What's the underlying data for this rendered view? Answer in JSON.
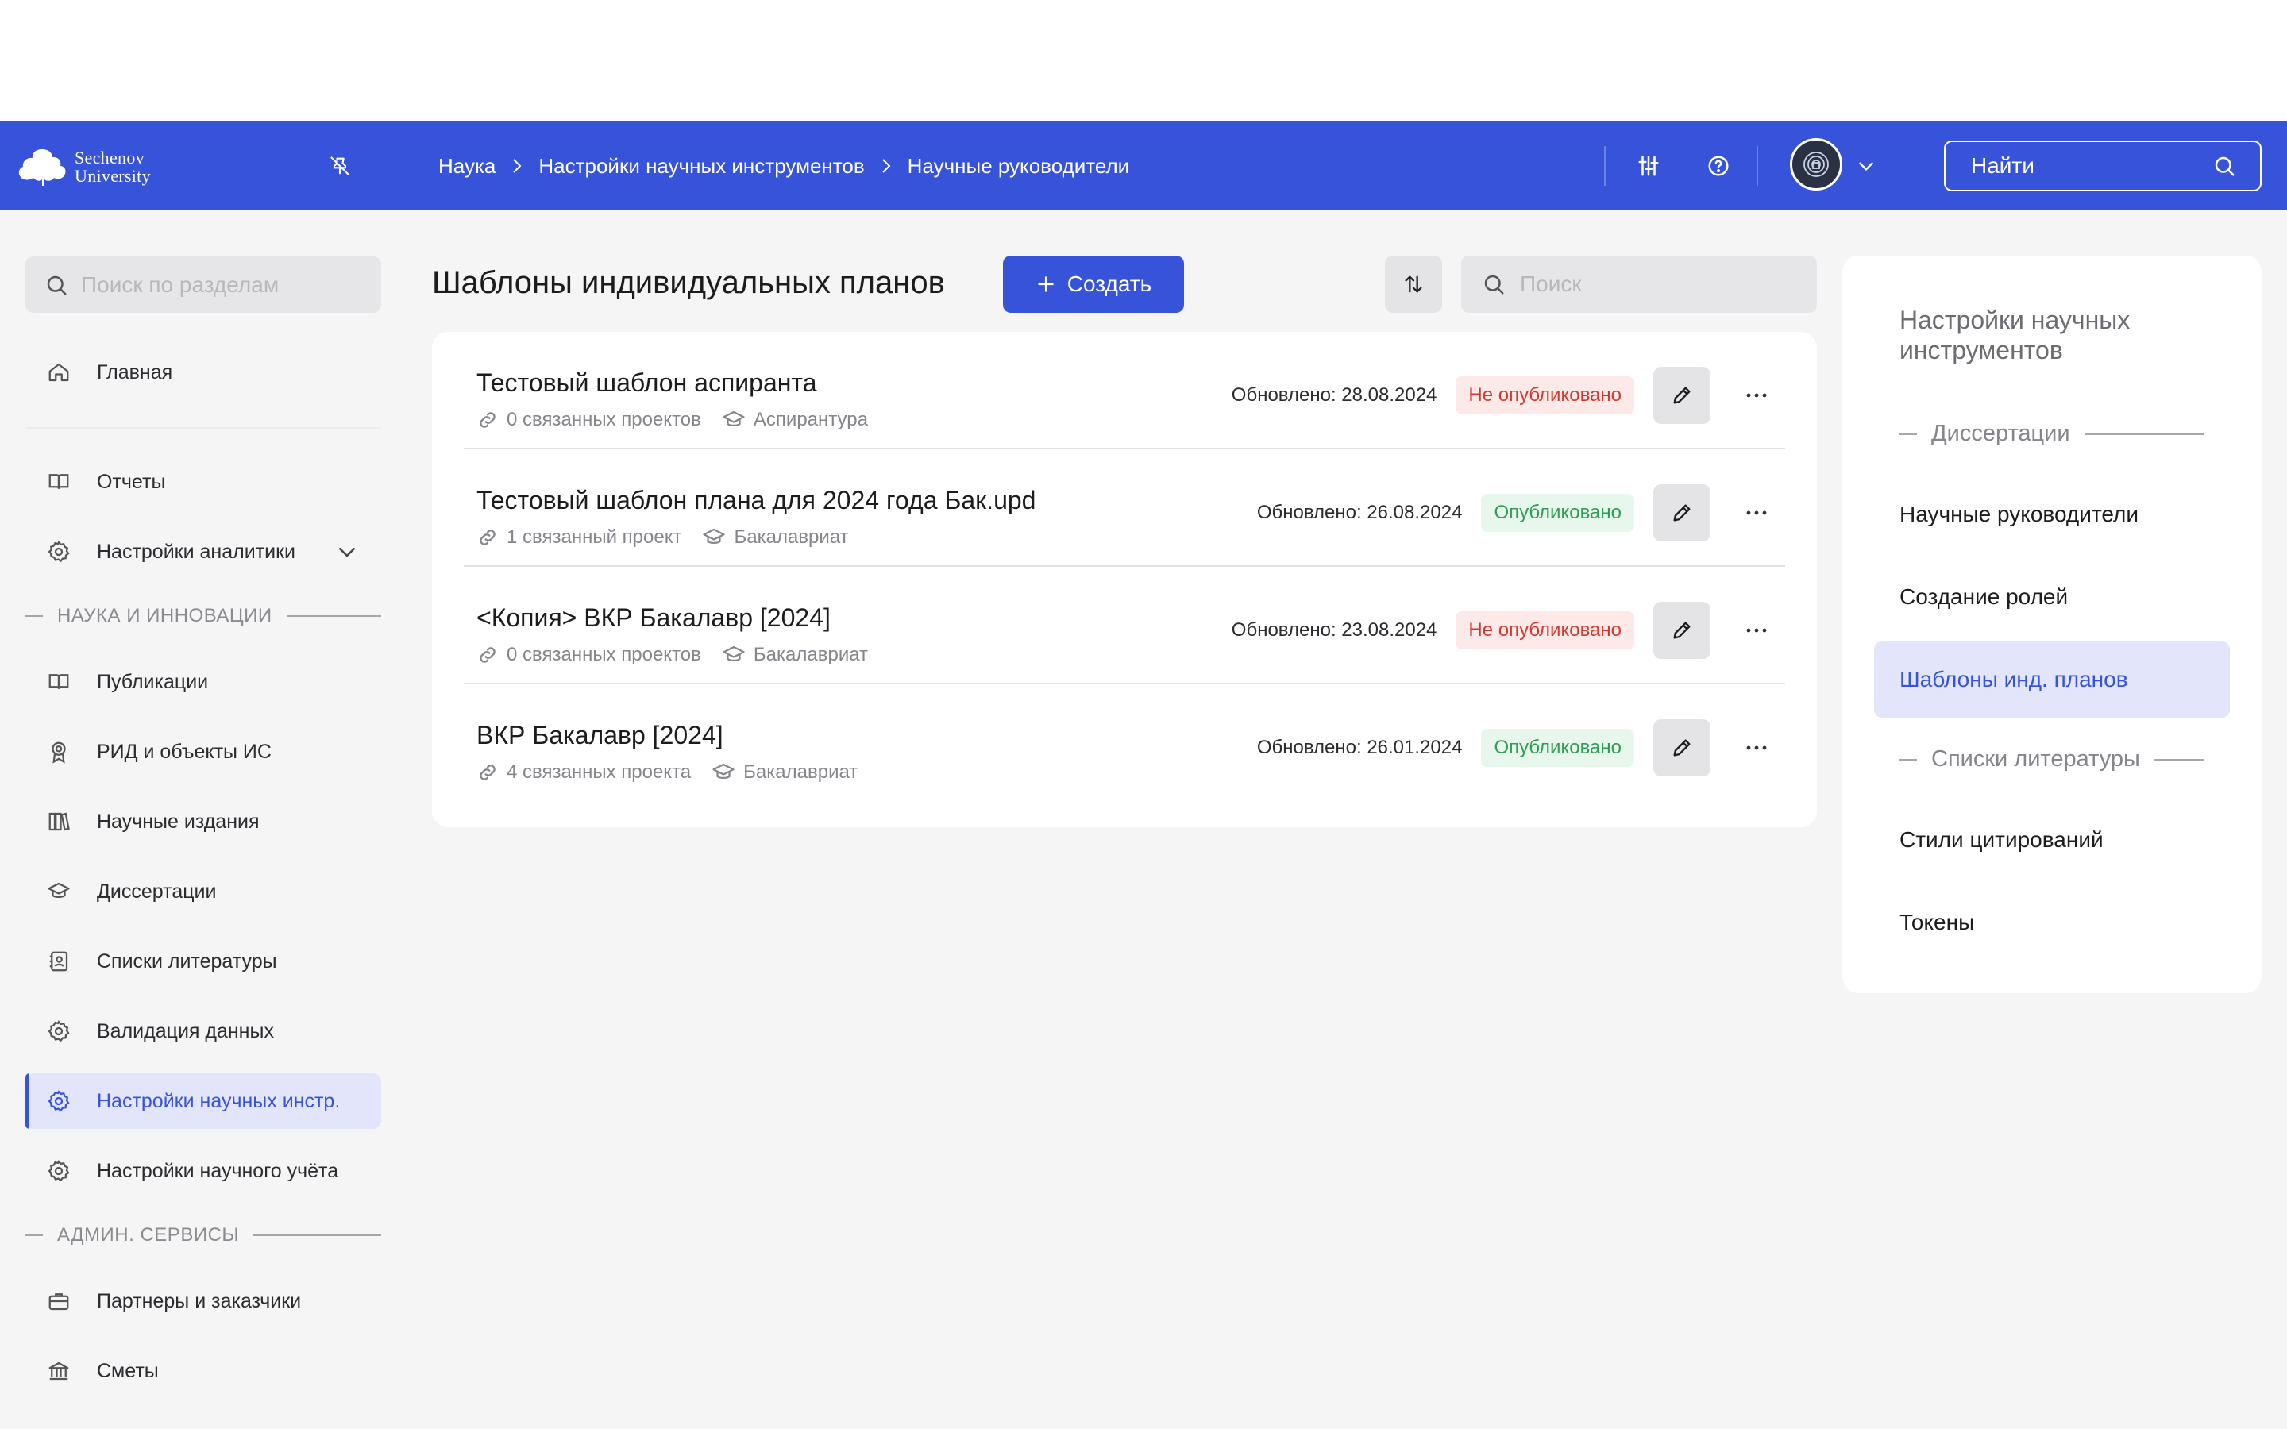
{
  "header": {
    "logo_line1": "Sechenov",
    "logo_line2": "University",
    "breadcrumbs": [
      "Наука",
      "Настройки научных инструментов",
      "Научные руководители"
    ],
    "search_label": "Найти",
    "brand_color": "#3753d9"
  },
  "sidebar": {
    "search_placeholder": "Поиск по разделам",
    "items": [
      {
        "label": "Главная",
        "icon": "home-icon"
      },
      {
        "label": "Отчеты",
        "icon": "book-icon"
      },
      {
        "label": "Настройки аналитики",
        "icon": "gear-icon"
      },
      {
        "label": "Публикации",
        "icon": "book-icon"
      },
      {
        "label": "РИД и объекты ИС",
        "icon": "award-icon"
      },
      {
        "label": "Научные издания",
        "icon": "library-icon"
      },
      {
        "label": "Диссертации",
        "icon": "graduation-cap-icon"
      },
      {
        "label": "Списки литературы",
        "icon": "contacts-book-icon"
      },
      {
        "label": "Валидация данных",
        "icon": "gear-icon"
      },
      {
        "label": "Настройки научных инстр.",
        "icon": "gear-icon"
      },
      {
        "label": "Настройки научного учёта",
        "icon": "gear-icon"
      },
      {
        "label": "Партнеры и заказчики",
        "icon": "briefcase-icon"
      },
      {
        "label": "Сметы",
        "icon": "bank-icon"
      }
    ],
    "sections": [
      "НАУКА И ИННОВАЦИИ",
      "АДМИН. СЕРВИСЫ"
    ]
  },
  "main": {
    "title": "Шаблоны индивидуальных планов",
    "create_label": "Создать",
    "search_placeholder": "Поиск",
    "rows": [
      {
        "title": "Тестовый шаблон аспиранта",
        "projects": "0 связанных проектов",
        "level": "Аспирантура",
        "updated": "Обновлено: 28.08.2024",
        "status": "Не опубликовано"
      },
      {
        "title": "Тестовый шаблон плана для 2024 года Бак.upd",
        "projects": "1 связанный проект",
        "level": "Бакалавриат",
        "updated": "Обновлено: 26.08.2024",
        "status": "Опубликовано"
      },
      {
        "title": "<Копия> ВКР Бакалавр [2024]",
        "projects": "0 связанных проектов",
        "level": "Бакалавриат",
        "updated": "Обновлено: 23.08.2024",
        "status": "Не опубликовано"
      },
      {
        "title": "ВКР Бакалавр [2024]",
        "projects": "4 связанных проекта",
        "level": "Бакалавриат",
        "updated": "Обновлено: 26.01.2024",
        "status": "Опубликовано"
      }
    ]
  },
  "right_panel": {
    "title": "Настройки научных инструментов",
    "section1": "Диссертации",
    "section2": "Списки литературы",
    "items": [
      "Научные руководители",
      "Создание ролей",
      "Шаблоны инд. планов",
      "Стили цитирований",
      "Токены"
    ]
  }
}
